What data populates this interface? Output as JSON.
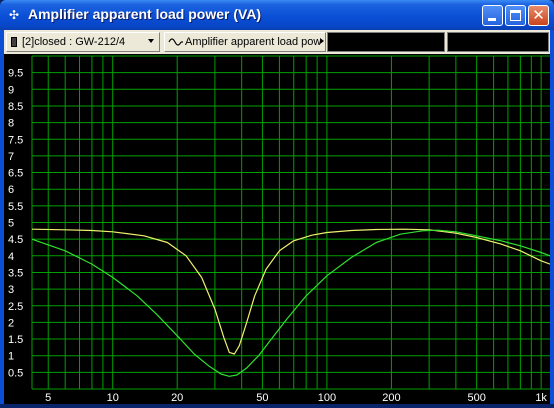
{
  "window": {
    "title": "Amplifier apparent load power (VA)",
    "icon": "crosshair-icon"
  },
  "toolbar": {
    "selector_label": "[2]closed : GW-212/4",
    "selector_icon": "device-icon",
    "measurement_label": "Amplifier apparent load pow",
    "measurement_icon": "sine-wave-icon"
  },
  "colors": {
    "grid": "#00a000",
    "curve_1": "#f0f070",
    "curve_2": "#30e030",
    "background": "#000000"
  },
  "chart_data": {
    "type": "line",
    "x_scale": "log",
    "xlim": [
      4.2,
      1100
    ],
    "ylim": [
      0,
      10
    ],
    "x_tick_labels": [
      "5",
      "10",
      "20",
      "50",
      "100",
      "200",
      "500",
      "1k"
    ],
    "x_tick_values": [
      5,
      10,
      20,
      50,
      100,
      200,
      500,
      1000
    ],
    "y_tick_labels": [
      "0.5",
      "1",
      "1.5",
      "2",
      "2.5",
      "3",
      "3.5",
      "4",
      "4.5",
      "5",
      "5.5",
      "6",
      "6.5",
      "7",
      "7.5",
      "8",
      "8.5",
      "9",
      "9.5"
    ],
    "grid": true,
    "series": [
      {
        "color": "#f0f070",
        "x": [
          4.2,
          6,
          8,
          10,
          14,
          18,
          22,
          26,
          30,
          33,
          35,
          37,
          39,
          42,
          46,
          52,
          60,
          70,
          85,
          100,
          130,
          170,
          230,
          300,
          400,
          500,
          650,
          800,
          1000,
          1100
        ],
        "y": [
          4.8,
          4.78,
          4.76,
          4.72,
          4.6,
          4.4,
          4.0,
          3.35,
          2.4,
          1.55,
          1.1,
          1.05,
          1.3,
          1.95,
          2.8,
          3.6,
          4.15,
          4.45,
          4.62,
          4.7,
          4.76,
          4.79,
          4.8,
          4.78,
          4.68,
          4.55,
          4.35,
          4.15,
          3.85,
          3.75
        ]
      },
      {
        "color": "#30e030",
        "x": [
          4.2,
          6,
          8,
          10,
          13,
          16,
          20,
          24,
          28,
          32,
          35,
          38,
          42,
          48,
          55,
          65,
          80,
          100,
          130,
          170,
          220,
          280,
          330,
          400,
          500,
          650,
          800,
          1000,
          1100
        ],
        "y": [
          4.5,
          4.15,
          3.75,
          3.35,
          2.8,
          2.25,
          1.6,
          1.05,
          0.7,
          0.45,
          0.38,
          0.42,
          0.62,
          1.0,
          1.5,
          2.1,
          2.8,
          3.4,
          3.95,
          4.4,
          4.65,
          4.75,
          4.77,
          4.72,
          4.6,
          4.45,
          4.3,
          4.1,
          4.0
        ]
      }
    ]
  }
}
